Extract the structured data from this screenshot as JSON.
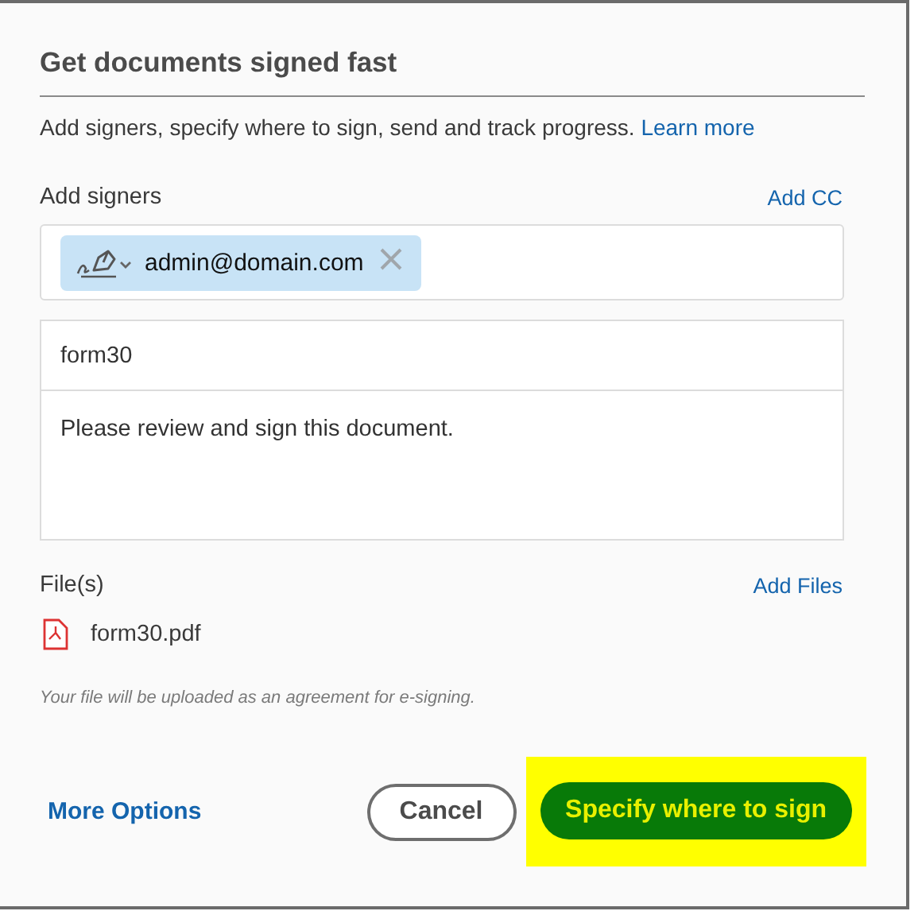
{
  "dialog": {
    "title": "Get documents signed fast",
    "description": "Add signers, specify where to sign, send and track progress.",
    "learn_more": "Learn more"
  },
  "signers": {
    "label": "Add signers",
    "add_cc": "Add CC",
    "chips": [
      {
        "email": "admin@domain.com"
      }
    ]
  },
  "agreement_name": {
    "value": "form30"
  },
  "message": {
    "value": "Please review and sign this document."
  },
  "files": {
    "label": "File(s)",
    "add_files": "Add Files",
    "items": [
      {
        "name": "form30.pdf"
      }
    ],
    "note": "Your file will be uploaded as an agreement for e-signing."
  },
  "footer": {
    "more_options": "More Options",
    "cancel": "Cancel",
    "primary": "Specify where to sign",
    "primary_highlighted": true
  }
}
